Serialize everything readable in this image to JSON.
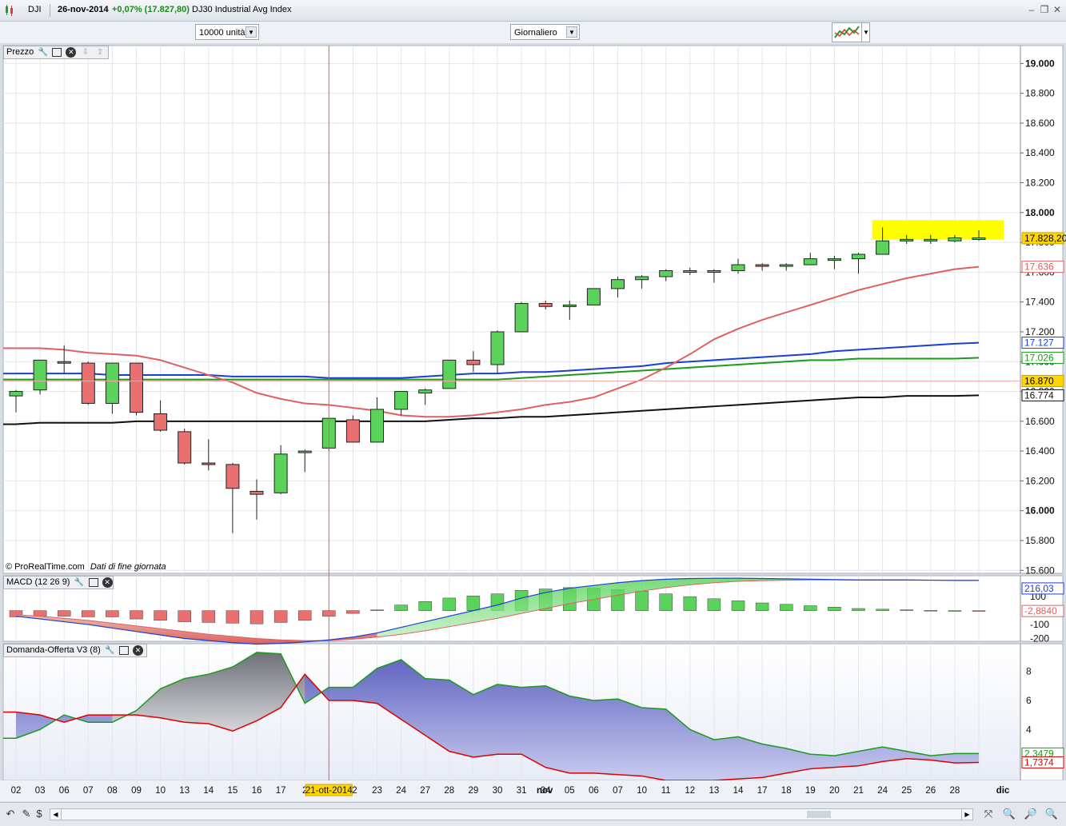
{
  "titlebar": {
    "symbol": "DJI",
    "date": "26-nov-2014",
    "change": "+0,07% (17.827,80)",
    "name": "DJ30 Industrial Avg Index"
  },
  "toolbar": {
    "units": "10000 unità",
    "period": "Giornaliero"
  },
  "panels": {
    "price": {
      "title": "Prezzo",
      "copyright": "© ProRealTime.com",
      "note": "Dati di fine giornata"
    },
    "macd": {
      "title": "MACD (12 26 9)"
    },
    "demand": {
      "title": "Domanda-Offerta V3 (8)"
    }
  },
  "colors": {
    "up": "#5bd35b",
    "down": "#e87070",
    "highlight": "#ffff00",
    "ma_red": "#e06060",
    "ma_blue": "#1a3fd6",
    "ma_green": "#1c9a1c",
    "ma_black": "#111111",
    "cursor": "#e06060"
  },
  "price_axis": {
    "ticks": [
      "19.000",
      "18.800",
      "18.600",
      "18.400",
      "18.200",
      "18.000",
      "17.800",
      "17.600",
      "17.400",
      "17.200",
      "17.000",
      "16.800",
      "16.600",
      "16.400",
      "16.200",
      "16.000",
      "15.800",
      "15.600"
    ],
    "bold_ticks": [
      "19.000",
      "18.000",
      "16.000"
    ],
    "badges": [
      {
        "text": "17.828,20",
        "value": 17828,
        "bg": "#ffd700",
        "fg": "#000",
        "border": "#c9a400"
      },
      {
        "text": "17.636",
        "value": 17636,
        "bg": "#fff",
        "fg": "#e06060",
        "border": "#e06060"
      },
      {
        "text": "17.127",
        "value": 17127,
        "bg": "#fff",
        "fg": "#1a3fd6",
        "border": "#1a3fd6"
      },
      {
        "text": "17.026",
        "value": 17026,
        "bg": "#fff",
        "fg": "#1c9a1c",
        "border": "#1c9a1c"
      },
      {
        "text": "16.870",
        "value": 16870,
        "bg": "#ffd700",
        "fg": "#000",
        "border": "#c9a400"
      },
      {
        "text": "16.774",
        "value": 16774,
        "bg": "#fff",
        "fg": "#111",
        "border": "#111"
      }
    ]
  },
  "macd_axis": {
    "ticks": [
      "100",
      "-100",
      "-200"
    ],
    "badges": [
      {
        "text": "216,03",
        "bg": "#fff",
        "fg": "#1a3fd6",
        "border": "#1a3fd6"
      },
      {
        "text": "-2,8840",
        "bg": "#fff",
        "fg": "#e06060",
        "border": "#e06060"
      }
    ]
  },
  "demand_axis": {
    "ticks": [
      "8",
      "6",
      "4"
    ],
    "badges": [
      {
        "text": "2,3479",
        "bg": "#fff",
        "fg": "#1c9a1c",
        "border": "#1c9a1c"
      },
      {
        "text": "1,7374",
        "bg": "#fff",
        "fg": "#e00000",
        "border": "#e00000"
      }
    ]
  },
  "x_axis": {
    "labels": [
      "02",
      "03",
      "06",
      "07",
      "08",
      "09",
      "10",
      "13",
      "14",
      "15",
      "16",
      "17",
      "2",
      "21-ott-2014",
      "2",
      "23",
      "24",
      "27",
      "28",
      "29",
      "30",
      "31",
      "nov",
      "04",
      "05",
      "06",
      "07",
      "10",
      "11",
      "12",
      "13",
      "14",
      "17",
      "18",
      "19",
      "20",
      "21",
      "24",
      "25",
      "26",
      "28",
      "dic"
    ],
    "cursor_label": "21-ott-2014"
  },
  "chart_data": [
    {
      "type": "candlestick",
      "title": "DJ30 Industrial Avg Index",
      "dates": [
        "02",
        "03",
        "06",
        "07",
        "08",
        "09",
        "10",
        "13",
        "14",
        "15",
        "16",
        "17",
        "20",
        "21",
        "22",
        "23",
        "24",
        "27",
        "28",
        "29",
        "30",
        "31",
        "03",
        "04",
        "05",
        "06",
        "07",
        "10",
        "11",
        "12",
        "13",
        "14",
        "17",
        "18",
        "19",
        "20",
        "21",
        "24",
        "25",
        "26",
        "28"
      ],
      "ohlc": [
        [
          16770,
          16810,
          16660,
          16800
        ],
        [
          16810,
          17010,
          16780,
          17010
        ],
        [
          17000,
          17110,
          16920,
          16990
        ],
        [
          16990,
          17000,
          16710,
          16720
        ],
        [
          16720,
          16990,
          16650,
          16990
        ],
        [
          16990,
          16990,
          16640,
          16660
        ],
        [
          16650,
          16740,
          16530,
          16540
        ],
        [
          16530,
          16550,
          16310,
          16320
        ],
        [
          16320,
          16480,
          16270,
          16310
        ],
        [
          16310,
          16320,
          15850,
          16150
        ],
        [
          16130,
          16210,
          15940,
          16110
        ],
        [
          16120,
          16440,
          16110,
          16380
        ],
        [
          16390,
          16410,
          16260,
          16400
        ],
        [
          16420,
          16620,
          16400,
          16620
        ],
        [
          16610,
          16640,
          16460,
          16460
        ],
        [
          16460,
          16760,
          16460,
          16680
        ],
        [
          16680,
          16800,
          16640,
          16800
        ],
        [
          16790,
          16820,
          16710,
          16810
        ],
        [
          16820,
          17010,
          16820,
          17010
        ],
        [
          17010,
          17070,
          16930,
          16980
        ],
        [
          16980,
          17210,
          16920,
          17200
        ],
        [
          17200,
          17400,
          17200,
          17390
        ],
        [
          17390,
          17410,
          17350,
          17370
        ],
        [
          17380,
          17410,
          17280,
          17380
        ],
        [
          17380,
          17490,
          17380,
          17490
        ],
        [
          17490,
          17570,
          17430,
          17550
        ],
        [
          17550,
          17580,
          17490,
          17570
        ],
        [
          17570,
          17620,
          17540,
          17610
        ],
        [
          17610,
          17630,
          17580,
          17610
        ],
        [
          17600,
          17620,
          17530,
          17610
        ],
        [
          17610,
          17690,
          17590,
          17650
        ],
        [
          17650,
          17660,
          17610,
          17640
        ],
        [
          17640,
          17660,
          17610,
          17650
        ],
        [
          17650,
          17730,
          17650,
          17690
        ],
        [
          17690,
          17710,
          17620,
          17690
        ],
        [
          17690,
          17730,
          17590,
          17720
        ],
        [
          17720,
          17900,
          17720,
          17810
        ],
        [
          17810,
          17850,
          17790,
          17820
        ],
        [
          17820,
          17850,
          17790,
          17820
        ],
        [
          17810,
          17850,
          17800,
          17830
        ],
        [
          17830,
          17880,
          17810,
          17830
        ]
      ],
      "ma_red": [
        17090,
        17090,
        17080,
        17060,
        17050,
        17040,
        17010,
        16960,
        16910,
        16860,
        16790,
        16750,
        16720,
        16710,
        16690,
        16670,
        16640,
        16630,
        16630,
        16640,
        16660,
        16680,
        16710,
        16730,
        16760,
        16820,
        16880,
        16960,
        17050,
        17150,
        17220,
        17280,
        17330,
        17380,
        17430,
        17480,
        17520,
        17560,
        17590,
        17620,
        17636
      ],
      "ma_blue": [
        16920,
        16920,
        16920,
        16920,
        16910,
        16910,
        16910,
        16910,
        16910,
        16900,
        16900,
        16900,
        16900,
        16890,
        16890,
        16890,
        16890,
        16900,
        16910,
        16920,
        16920,
        16930,
        16930,
        16940,
        16950,
        16960,
        16970,
        16990,
        17000,
        17010,
        17020,
        17030,
        17040,
        17050,
        17070,
        17080,
        17090,
        17100,
        17110,
        17120,
        17127
      ],
      "ma_green": [
        16880,
        16880,
        16880,
        16880,
        16880,
        16880,
        16880,
        16880,
        16880,
        16880,
        16880,
        16880,
        16880,
        16880,
        16880,
        16880,
        16880,
        16880,
        16880,
        16880,
        16880,
        16890,
        16900,
        16910,
        16920,
        16930,
        16940,
        16950,
        16960,
        16970,
        16980,
        16990,
        17000,
        17010,
        17010,
        17020,
        17020,
        17020,
        17020,
        17020,
        17026
      ],
      "ma_black": [
        16580,
        16590,
        16590,
        16590,
        16590,
        16600,
        16600,
        16600,
        16600,
        16600,
        16600,
        16600,
        16600,
        16600,
        16600,
        16600,
        16600,
        16600,
        16610,
        16620,
        16620,
        16630,
        16630,
        16640,
        16650,
        16660,
        16670,
        16680,
        16690,
        16700,
        16710,
        16720,
        16730,
        16740,
        16750,
        16760,
        16760,
        16770,
        16770,
        16770,
        16774
      ],
      "ylim": [
        15580,
        19120
      ],
      "highlight_range": [
        17820,
        17950
      ]
    },
    {
      "type": "macd",
      "title": "MACD (12 26 9)",
      "histogram": [
        -45,
        -40,
        -40,
        -45,
        -45,
        -60,
        -70,
        -80,
        -85,
        -90,
        -95,
        -85,
        -70,
        -40,
        -20,
        5,
        40,
        65,
        90,
        105,
        120,
        145,
        155,
        165,
        160,
        150,
        140,
        120,
        100,
        85,
        70,
        55,
        45,
        35,
        25,
        15,
        10,
        6,
        2,
        0,
        -3
      ],
      "macd": [
        -40,
        -60,
        -80,
        -100,
        -125,
        -150,
        -175,
        -200,
        -215,
        -230,
        -240,
        -235,
        -225,
        -210,
        -190,
        -160,
        -120,
        -80,
        -40,
        0,
        40,
        90,
        130,
        160,
        180,
        200,
        215,
        225,
        230,
        232,
        232,
        230,
        228,
        225,
        222,
        220,
        220,
        220,
        218,
        216,
        216
      ],
      "signal": [
        -30,
        -40,
        -55,
        -70,
        -90,
        -110,
        -130,
        -150,
        -170,
        -185,
        -200,
        -210,
        -215,
        -215,
        -205,
        -190,
        -170,
        -145,
        -115,
        -85,
        -55,
        -20,
        15,
        50,
        80,
        110,
        140,
        165,
        185,
        200,
        210,
        215,
        218,
        220,
        220,
        218,
        218,
        218,
        218,
        218,
        218
      ],
      "ylim": [
        -220,
        250
      ]
    },
    {
      "type": "area",
      "title": "Domanda-Offerta V3 (8)",
      "green": [
        3.4,
        4.0,
        5.0,
        4.5,
        4.5,
        5.3,
        6.8,
        7.5,
        7.8,
        8.3,
        9.3,
        9.2,
        5.8,
        6.9,
        6.9,
        8.2,
        8.8,
        7.5,
        7.4,
        6.4,
        7.1,
        6.9,
        7.0,
        6.3,
        6.0,
        6.1,
        5.5,
        5.4,
        4.0,
        3.3,
        3.5,
        3.0,
        2.7,
        2.3,
        2.2,
        2.5,
        2.8,
        2.5,
        2.2,
        2.35,
        2.35
      ],
      "red": [
        5.2,
        5.0,
        4.5,
        5.0,
        5.0,
        5.0,
        4.8,
        4.5,
        4.4,
        3.9,
        4.6,
        5.5,
        7.8,
        6.0,
        6.0,
        5.8,
        4.7,
        3.6,
        2.5,
        2.1,
        2.3,
        2.3,
        1.4,
        1.0,
        1.0,
        0.9,
        0.8,
        0.5,
        0.5,
        0.5,
        0.6,
        0.7,
        1.0,
        1.3,
        1.4,
        1.5,
        1.8,
        2.0,
        1.9,
        1.7,
        1.74
      ],
      "ylim": [
        0.5,
        9.9
      ]
    }
  ]
}
